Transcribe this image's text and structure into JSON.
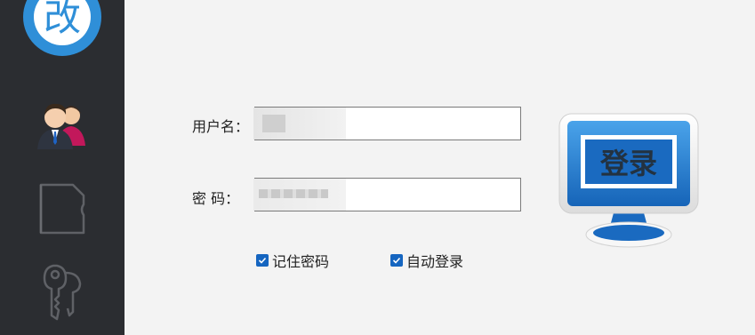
{
  "sidebar": {
    "logo_char": "改",
    "items": [
      {
        "icon": "users-icon"
      },
      {
        "icon": "document-icon"
      },
      {
        "icon": "keys-icon"
      }
    ]
  },
  "login_form": {
    "username_label": "用户名：",
    "password_label": "密 码：",
    "username_value": "",
    "password_value": "",
    "remember_password": {
      "label": "记住密码",
      "checked": true
    },
    "auto_login": {
      "label": "自动登录",
      "checked": true
    },
    "login_button_text": "登录"
  },
  "colors": {
    "sidebar_bg": "#2b2d31",
    "page_bg": "#f3f3f3",
    "accent": "#1565c0",
    "logo_circle": "#2f8fd8"
  }
}
